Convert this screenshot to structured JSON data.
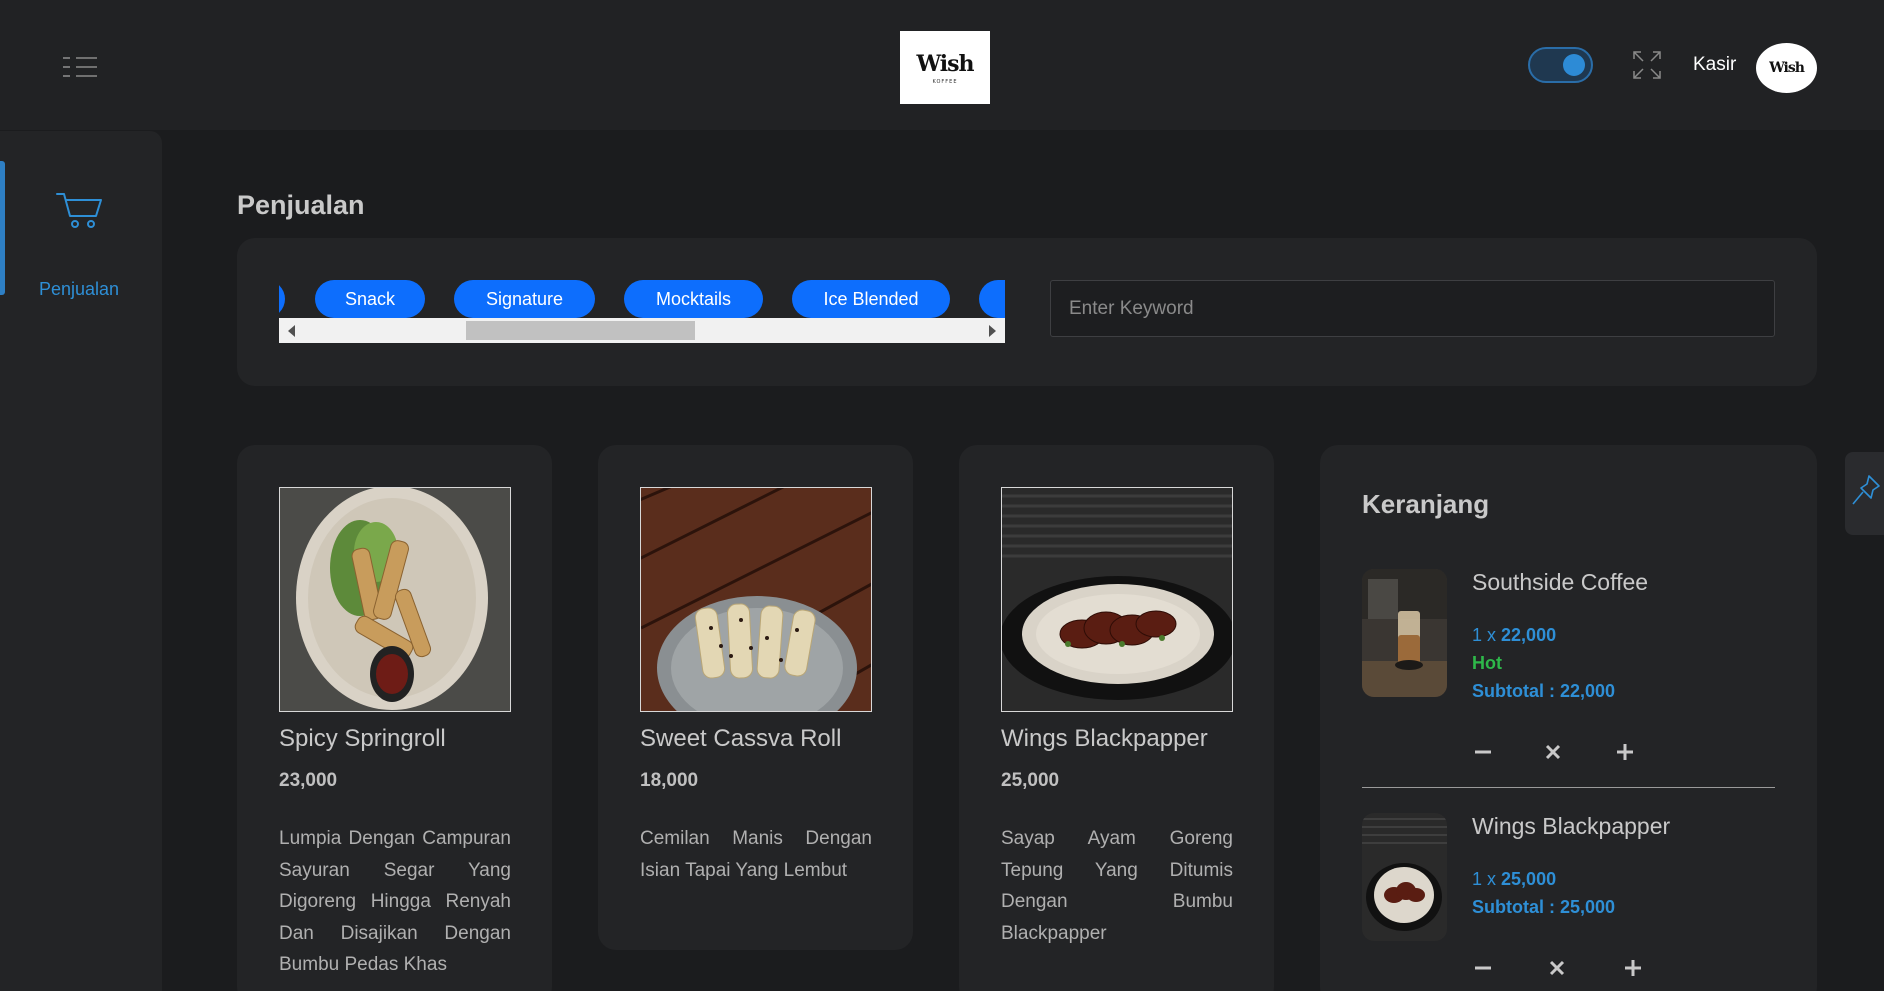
{
  "header": {
    "logo_text": "Wish",
    "logo_subtext": "KOFFEE",
    "user_name": "Kasir",
    "avatar_text": "Wish"
  },
  "sidebar": {
    "items": [
      {
        "label": "Penjualan",
        "icon": "cart-icon",
        "active": true
      }
    ]
  },
  "page": {
    "title": "Penjualan"
  },
  "categories": {
    "items": [
      "Snack",
      "Signature",
      "Mocktails",
      "Ice Blended"
    ]
  },
  "search": {
    "placeholder": "Enter Keyword",
    "value": ""
  },
  "products": [
    {
      "name": "Spicy Springroll",
      "price": "23,000",
      "description": "Lumpia Dengan Campuran Sayuran Segar Yang Digoreng Hingga Renyah Dan Disajikan Dengan Bumbu Pedas Khas"
    },
    {
      "name": "Sweet Cassva Roll",
      "price": "18,000",
      "description": "Cemilan Manis Dengan Isian Tapai Yang Lembut"
    },
    {
      "name": "Wings Blackpapper",
      "price": "25,000",
      "description": "Sayap Ayam Goreng Tepung Yang Ditumis Dengan Bumbu Blackpapper"
    }
  ],
  "cart": {
    "title": "Keranjang",
    "items": [
      {
        "name": "Southside Coffee",
        "qty": "1",
        "unit_price": "22,000",
        "variant": "Hot",
        "subtotal": "Subtotal : 22,000"
      },
      {
        "name": "Wings Blackpapper",
        "qty": "1",
        "unit_price": "25,000",
        "variant": "",
        "subtotal": "Subtotal : 25,000"
      }
    ]
  },
  "colors": {
    "background": "#1b1c1e",
    "card": "#232426",
    "chip": "#0d6efd",
    "accent": "#2e8fd6",
    "variant": "#2eb84a"
  }
}
